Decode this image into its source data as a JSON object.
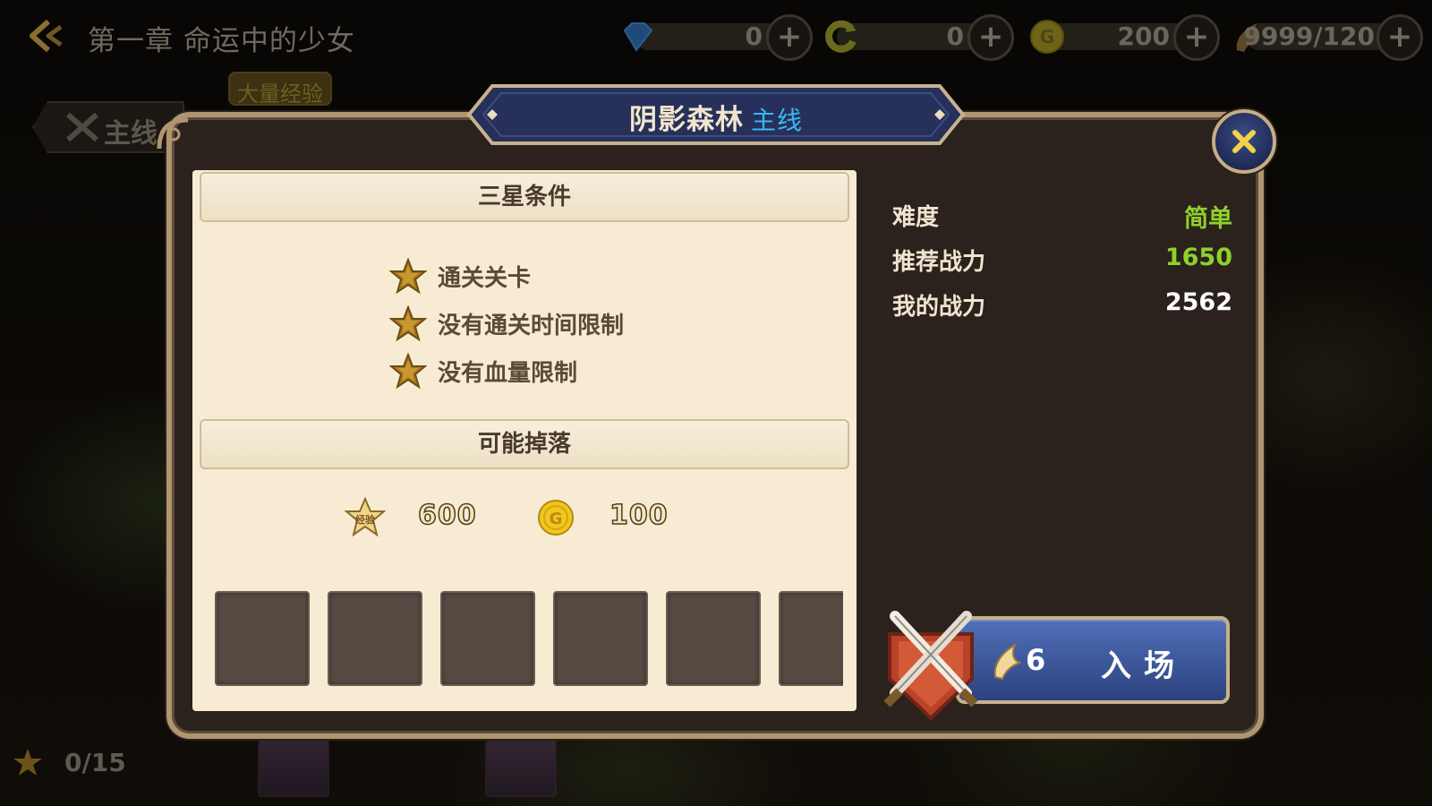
{
  "topbar": {
    "chapter_title": "第一章 命运中的少女",
    "resources": [
      {
        "icon": "diamond-icon",
        "value": "0"
      },
      {
        "icon": "refresh-currency-icon",
        "value": "0"
      },
      {
        "icon": "gold-coin-icon",
        "value": "200"
      },
      {
        "icon": "stamina-wing-icon",
        "value": "9999/120"
      }
    ],
    "plus_label": "+"
  },
  "background": {
    "mainline_tab_label": "主线",
    "exp_badge_label": "大量经验",
    "star_progress": "0/15"
  },
  "dialog": {
    "stage_name": "阴影森林",
    "stage_type": "主线",
    "three_star_header": "三星条件",
    "conditions": [
      "通关关卡",
      "没有通关时间限制",
      "没有血量限制"
    ],
    "drops_header": "可能掉落",
    "drop_exp_icon_label": "经验",
    "drop_exp": "600",
    "drop_gold": "100",
    "stats": {
      "difficulty_label": "难度",
      "difficulty_value": "简单",
      "recommended_label": "推荐战力",
      "recommended_value": "1650",
      "my_power_label": "我的战力",
      "my_power_value": "2562"
    },
    "enter_cost": "6",
    "enter_label": "入场",
    "close_label": "×"
  },
  "colors": {
    "difficulty": "#8fd12b",
    "recommended": "#8fd12b",
    "my_power": "#ffffff",
    "stage_type": "#38b8f2"
  }
}
